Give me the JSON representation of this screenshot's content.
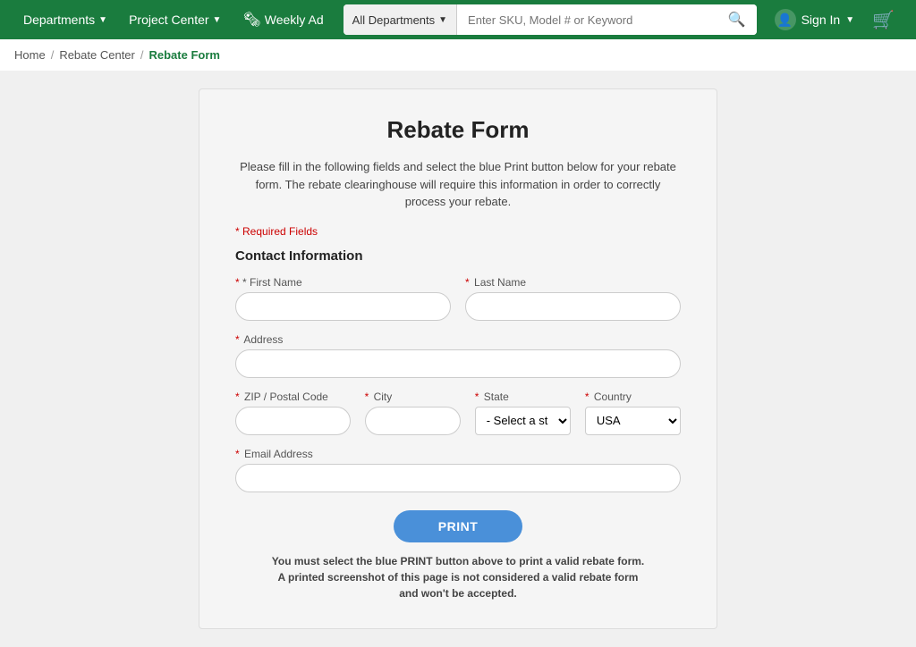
{
  "nav": {
    "departments_label": "Departments",
    "project_center_label": "Project Center",
    "weekly_ad_label": "Weekly Ad",
    "search_dept_label": "All Departments",
    "search_placeholder": "Enter SKU, Model # or Keyword",
    "sign_in_label": "Sign In",
    "cart_icon": "🛒"
  },
  "breadcrumb": {
    "home": "Home",
    "rebate_center": "Rebate Center",
    "current": "Rebate Form"
  },
  "form": {
    "title": "Rebate Form",
    "description": "Please fill in the following fields and select the blue Print button below for your rebate form. The rebate clearinghouse will require this information in order to correctly process your rebate.",
    "required_note": "* Required Fields",
    "section_title": "Contact Information",
    "first_name_label": "* First Name",
    "last_name_label": "* Last Name",
    "address_label": "* Address",
    "zip_label": "* ZIP / Postal Code",
    "city_label": "* City",
    "state_label": "* State",
    "country_label": "* Country",
    "email_label": "* Email Address",
    "state_placeholder": "- Select a state -",
    "country_default": "USA",
    "print_button": "PRINT",
    "print_note": "You must select the blue PRINT button above to print a valid rebate form. A printed screenshot of this page is not considered a valid rebate form and won't be accepted."
  }
}
